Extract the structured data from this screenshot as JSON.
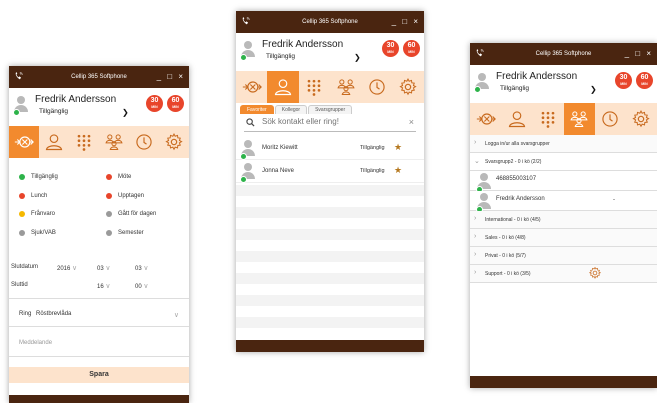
{
  "app": {
    "title": "Cellip 365 Softphone",
    "window_controls": "_ □ ×"
  },
  "profile": {
    "name": "Fredrik Andersson",
    "status": "Tillgänglig",
    "badge_1": {
      "value": "30",
      "unit": "MIN"
    },
    "badge_2": {
      "value": "60",
      "unit": "MIN"
    }
  },
  "colors": {
    "accent": "#f28a2e",
    "nav_bg": "#fde3cc",
    "titlebar": "#4a2510",
    "badge": "#e8452b"
  },
  "nav_icons": [
    "forward-icon",
    "contacts-icon",
    "dialpad-icon",
    "groups-icon",
    "history-icon",
    "settings-icon"
  ],
  "status_window": {
    "statuses": [
      {
        "label": "Tillgänglig",
        "color": "#2db34a"
      },
      {
        "label": "Möte",
        "color": "#e8452b"
      },
      {
        "label": "Lunch",
        "color": "#e8452b"
      },
      {
        "label": "Upptagen",
        "color": "#e8452b"
      },
      {
        "label": "Frånvaro",
        "color": "#f5b800"
      },
      {
        "label": "Gått för dagen",
        "color": "#9a9a9a"
      },
      {
        "label": "Sjuk/VAB",
        "color": "#9a9a9a"
      },
      {
        "label": "Semester",
        "color": "#9a9a9a"
      }
    ],
    "slutdatum_label": "Slutdatum",
    "slutdatum_year": "2016",
    "slutdatum_month": "03",
    "slutdatum_day": "03",
    "sluttid_label": "Sluttid",
    "sluttid_hour": "16",
    "sluttid_minute": "00",
    "ring_label": "Ring",
    "ring_value": "Röstbrevlåda",
    "message_placeholder": "Meddelande",
    "save_label": "Spara"
  },
  "contacts_window": {
    "tabs": [
      "Favoriter",
      "Kollegor",
      "Svarsgrupper"
    ],
    "search_placeholder": "Sök kontakt eller ring!",
    "contacts": [
      {
        "name": "Moritz Kiewitt",
        "status": "Tillgänglig"
      },
      {
        "name": "Jonna Neve",
        "status": "Tillgänglig"
      }
    ]
  },
  "groups_window": {
    "toggle_all": "Logga in/ur alla svarsgrupper",
    "expanded_group": "Svarsgrupp2 - 0 i kö (2/2)",
    "members": [
      {
        "name": "468855003107",
        "value": ""
      },
      {
        "name": "Fredrik Andersson",
        "value": "-"
      }
    ],
    "groups": [
      "International - 0 i kö (4/5)",
      "Sales - 0 i kö (4/8)",
      "Privat - 0 i kö (5/7)",
      "Support - 0 i kö (3/5)"
    ]
  }
}
